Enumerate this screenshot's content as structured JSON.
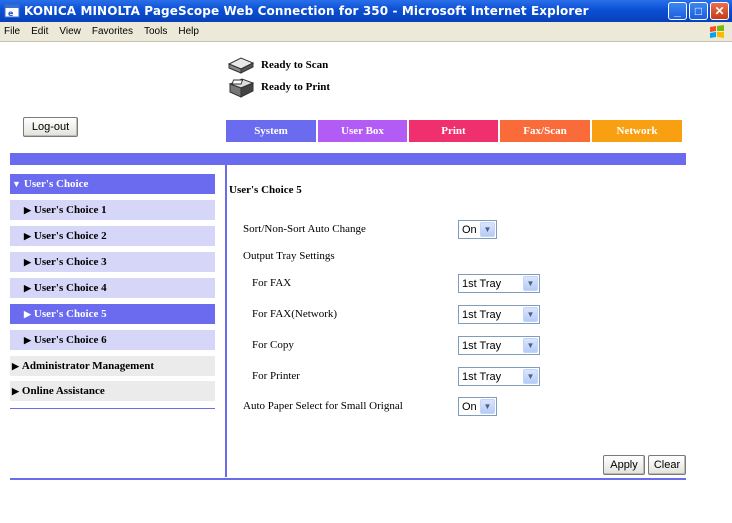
{
  "window": {
    "title": "KONICA MINOLTA PageScope Web Connection for 350 - Microsoft Internet Explorer"
  },
  "menu": [
    "File",
    "Edit",
    "View",
    "Favorites",
    "Tools",
    "Help"
  ],
  "status": {
    "scan": "Ready to Scan",
    "print": "Ready to Print"
  },
  "logout_label": "Log-out",
  "tabs": [
    {
      "label": "System",
      "color": "#6b6bf0"
    },
    {
      "label": "User Box",
      "color": "#b25cf5"
    },
    {
      "label": "Print",
      "color": "#f0306e"
    },
    {
      "label": "Fax/Scan",
      "color": "#f96c3a"
    },
    {
      "label": "Network",
      "color": "#f8a011"
    }
  ],
  "sidebar": {
    "header": "User's Choice",
    "items": [
      "User's Choice 1",
      "User's Choice 2",
      "User's Choice 3",
      "User's Choice 4",
      "User's Choice 5",
      "User's Choice 6"
    ],
    "active_index": 4,
    "admin": "Administrator Management",
    "online": "Online Assistance"
  },
  "main": {
    "title": "User's Choice 5",
    "sort_label": "Sort/Non-Sort Auto Change",
    "sort_value": "On",
    "output_label": "Output Tray Settings",
    "fax_label": "For FAX",
    "fax_value": "1st Tray",
    "faxnet_label": "For FAX(Network)",
    "faxnet_value": "1st Tray",
    "copy_label": "For Copy",
    "copy_value": "1st Tray",
    "printer_label": "For Printer",
    "printer_value": "1st Tray",
    "autopaper_label": "Auto Paper Select for Small Orignal",
    "autopaper_value": "On"
  },
  "buttons": {
    "apply": "Apply",
    "clear": "Clear"
  }
}
